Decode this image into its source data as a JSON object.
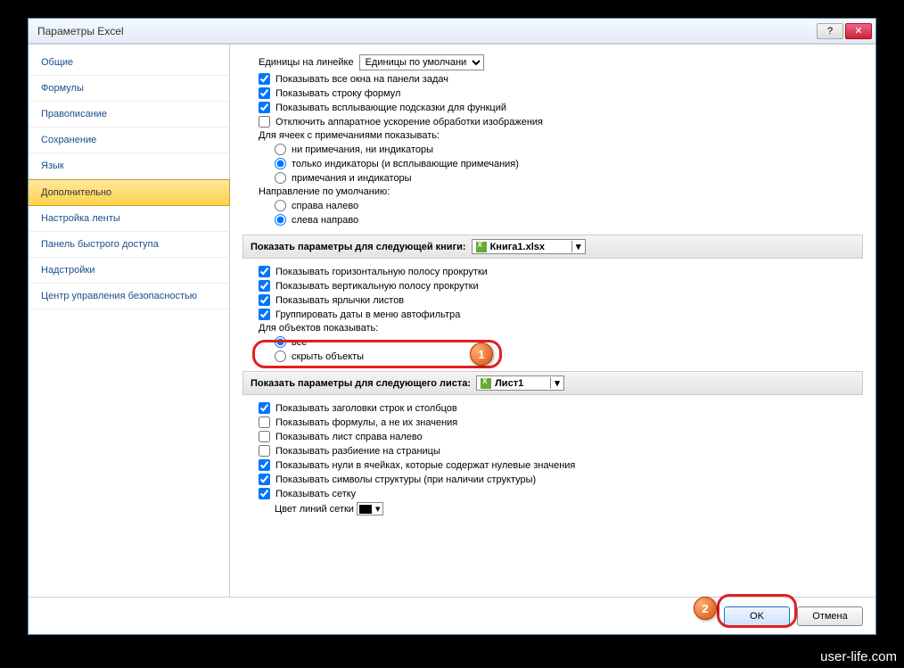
{
  "window": {
    "title": "Параметры Excel"
  },
  "sidebar": {
    "items": [
      "Общие",
      "Формулы",
      "Правописание",
      "Сохранение",
      "Язык",
      "Дополнительно",
      "Настройка ленты",
      "Панель быстрого доступа",
      "Надстройки",
      "Центр управления безопасностью"
    ],
    "selected_index": 5
  },
  "ruler": {
    "label": "Единицы на линейке",
    "value": "Единицы по умолчанию"
  },
  "display": {
    "show_all_windows": "Показывать все окна на панели задач",
    "show_formula_bar": "Показывать строку формул",
    "show_tooltips": "Показывать всплывающие подсказки для функций",
    "disable_hw": "Отключить аппаратное ускорение обработки изображения",
    "comments_header": "Для ячеек с примечаниями показывать:",
    "comments_opts": [
      "ни примечания, ни индикаторы",
      "только индикаторы (и всплывающие примечания)",
      "примечания и индикаторы"
    ],
    "comments_selected": 1,
    "direction_header": "Направление по умолчанию:",
    "direction_opts": [
      "справа налево",
      "слева направо"
    ],
    "direction_selected": 1
  },
  "workbook": {
    "section_label": "Показать параметры для следующей книги:",
    "combo_value": "Книга1.xlsx",
    "items": [
      {
        "label": "Показывать горизонтальную полосу прокрутки",
        "checked": true
      },
      {
        "label": "Показывать вертикальную полосу прокрутки",
        "checked": true
      },
      {
        "label": "Показывать ярлычки листов",
        "checked": true
      },
      {
        "label": "Группировать даты в меню автофильтра",
        "checked": true
      }
    ],
    "objects_header": "Для объектов показывать:",
    "objects_opts": [
      "все",
      "скрыть объекты"
    ],
    "objects_selected": 0
  },
  "sheet": {
    "section_label": "Показать параметры для следующего листа:",
    "combo_value": "Лист1",
    "items": [
      {
        "label": "Показывать заголовки строк и столбцов",
        "checked": true
      },
      {
        "label": "Показывать формулы, а не их значения",
        "checked": false
      },
      {
        "label": "Показывать лист справа налево",
        "checked": false
      },
      {
        "label": "Показывать разбиение на страницы",
        "checked": false
      },
      {
        "label": "Показывать нули в ячейках, которые содержат нулевые значения",
        "checked": true
      },
      {
        "label": "Показывать символы структуры (при наличии структуры)",
        "checked": true
      },
      {
        "label": "Показывать сетку",
        "checked": true
      }
    ],
    "gridline_label": "Цвет линий сетки"
  },
  "footer": {
    "ok": "OK",
    "cancel": "Отмена"
  },
  "annotations": {
    "b1": "1",
    "b2": "2"
  },
  "watermark": "user-life.com"
}
